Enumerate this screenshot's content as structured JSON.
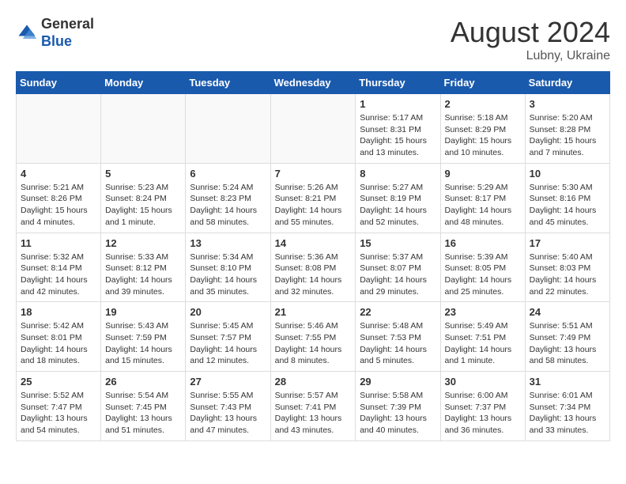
{
  "header": {
    "title": "August 2024",
    "location": "Lubny, Ukraine",
    "logo_general": "General",
    "logo_blue": "Blue"
  },
  "days_of_week": [
    "Sunday",
    "Monday",
    "Tuesday",
    "Wednesday",
    "Thursday",
    "Friday",
    "Saturday"
  ],
  "weeks": [
    [
      {
        "day": "",
        "info": ""
      },
      {
        "day": "",
        "info": ""
      },
      {
        "day": "",
        "info": ""
      },
      {
        "day": "",
        "info": ""
      },
      {
        "day": "1",
        "info": "Sunrise: 5:17 AM\nSunset: 8:31 PM\nDaylight: 15 hours\nand 13 minutes."
      },
      {
        "day": "2",
        "info": "Sunrise: 5:18 AM\nSunset: 8:29 PM\nDaylight: 15 hours\nand 10 minutes."
      },
      {
        "day": "3",
        "info": "Sunrise: 5:20 AM\nSunset: 8:28 PM\nDaylight: 15 hours\nand 7 minutes."
      }
    ],
    [
      {
        "day": "4",
        "info": "Sunrise: 5:21 AM\nSunset: 8:26 PM\nDaylight: 15 hours\nand 4 minutes."
      },
      {
        "day": "5",
        "info": "Sunrise: 5:23 AM\nSunset: 8:24 PM\nDaylight: 15 hours\nand 1 minute."
      },
      {
        "day": "6",
        "info": "Sunrise: 5:24 AM\nSunset: 8:23 PM\nDaylight: 14 hours\nand 58 minutes."
      },
      {
        "day": "7",
        "info": "Sunrise: 5:26 AM\nSunset: 8:21 PM\nDaylight: 14 hours\nand 55 minutes."
      },
      {
        "day": "8",
        "info": "Sunrise: 5:27 AM\nSunset: 8:19 PM\nDaylight: 14 hours\nand 52 minutes."
      },
      {
        "day": "9",
        "info": "Sunrise: 5:29 AM\nSunset: 8:17 PM\nDaylight: 14 hours\nand 48 minutes."
      },
      {
        "day": "10",
        "info": "Sunrise: 5:30 AM\nSunset: 8:16 PM\nDaylight: 14 hours\nand 45 minutes."
      }
    ],
    [
      {
        "day": "11",
        "info": "Sunrise: 5:32 AM\nSunset: 8:14 PM\nDaylight: 14 hours\nand 42 minutes."
      },
      {
        "day": "12",
        "info": "Sunrise: 5:33 AM\nSunset: 8:12 PM\nDaylight: 14 hours\nand 39 minutes."
      },
      {
        "day": "13",
        "info": "Sunrise: 5:34 AM\nSunset: 8:10 PM\nDaylight: 14 hours\nand 35 minutes."
      },
      {
        "day": "14",
        "info": "Sunrise: 5:36 AM\nSunset: 8:08 PM\nDaylight: 14 hours\nand 32 minutes."
      },
      {
        "day": "15",
        "info": "Sunrise: 5:37 AM\nSunset: 8:07 PM\nDaylight: 14 hours\nand 29 minutes."
      },
      {
        "day": "16",
        "info": "Sunrise: 5:39 AM\nSunset: 8:05 PM\nDaylight: 14 hours\nand 25 minutes."
      },
      {
        "day": "17",
        "info": "Sunrise: 5:40 AM\nSunset: 8:03 PM\nDaylight: 14 hours\nand 22 minutes."
      }
    ],
    [
      {
        "day": "18",
        "info": "Sunrise: 5:42 AM\nSunset: 8:01 PM\nDaylight: 14 hours\nand 18 minutes."
      },
      {
        "day": "19",
        "info": "Sunrise: 5:43 AM\nSunset: 7:59 PM\nDaylight: 14 hours\nand 15 minutes."
      },
      {
        "day": "20",
        "info": "Sunrise: 5:45 AM\nSunset: 7:57 PM\nDaylight: 14 hours\nand 12 minutes."
      },
      {
        "day": "21",
        "info": "Sunrise: 5:46 AM\nSunset: 7:55 PM\nDaylight: 14 hours\nand 8 minutes."
      },
      {
        "day": "22",
        "info": "Sunrise: 5:48 AM\nSunset: 7:53 PM\nDaylight: 14 hours\nand 5 minutes."
      },
      {
        "day": "23",
        "info": "Sunrise: 5:49 AM\nSunset: 7:51 PM\nDaylight: 14 hours\nand 1 minute."
      },
      {
        "day": "24",
        "info": "Sunrise: 5:51 AM\nSunset: 7:49 PM\nDaylight: 13 hours\nand 58 minutes."
      }
    ],
    [
      {
        "day": "25",
        "info": "Sunrise: 5:52 AM\nSunset: 7:47 PM\nDaylight: 13 hours\nand 54 minutes."
      },
      {
        "day": "26",
        "info": "Sunrise: 5:54 AM\nSunset: 7:45 PM\nDaylight: 13 hours\nand 51 minutes."
      },
      {
        "day": "27",
        "info": "Sunrise: 5:55 AM\nSunset: 7:43 PM\nDaylight: 13 hours\nand 47 minutes."
      },
      {
        "day": "28",
        "info": "Sunrise: 5:57 AM\nSunset: 7:41 PM\nDaylight: 13 hours\nand 43 minutes."
      },
      {
        "day": "29",
        "info": "Sunrise: 5:58 AM\nSunset: 7:39 PM\nDaylight: 13 hours\nand 40 minutes."
      },
      {
        "day": "30",
        "info": "Sunrise: 6:00 AM\nSunset: 7:37 PM\nDaylight: 13 hours\nand 36 minutes."
      },
      {
        "day": "31",
        "info": "Sunrise: 6:01 AM\nSunset: 7:34 PM\nDaylight: 13 hours\nand 33 minutes."
      }
    ]
  ]
}
